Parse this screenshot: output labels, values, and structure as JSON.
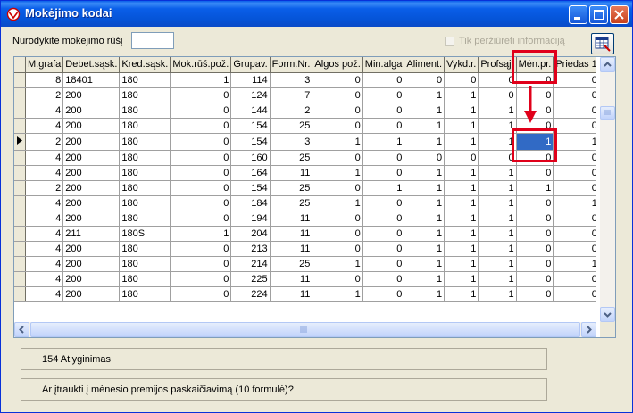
{
  "window": {
    "title": "Mokėjimo kodai"
  },
  "filter": {
    "code_label": "Nurodykite mokėjimo rūšį",
    "code_value": "",
    "view_only_label": "Tik peržiūrėti informaciją",
    "view_only_checked": false
  },
  "toolbar": {
    "tool_icon": "table-export-icon"
  },
  "grid": {
    "columns": [
      "M.grafa",
      "Debet.sąsk.",
      "Kred.sąsk.",
      "Mok.rūš.pož.",
      "Grupav.",
      "Form.Nr.",
      "Algos pož.",
      "Min.alga",
      "Aliment.",
      "Vykd.r.",
      "Profsąj.",
      "Mėn.pr.",
      "Priedas 1",
      "P"
    ],
    "rows": [
      [
        "8",
        "18401",
        "180",
        "1",
        "114",
        "3",
        "0",
        "0",
        "0",
        "0",
        "0",
        "0",
        "0",
        ""
      ],
      [
        "2",
        "200",
        "180",
        "0",
        "124",
        "7",
        "0",
        "0",
        "1",
        "1",
        "0",
        "0",
        "0",
        ""
      ],
      [
        "4",
        "200",
        "180",
        "0",
        "144",
        "2",
        "0",
        "0",
        "1",
        "1",
        "1",
        "0",
        "0",
        ""
      ],
      [
        "4",
        "200",
        "180",
        "0",
        "154",
        "25",
        "0",
        "0",
        "1",
        "1",
        "1",
        "0",
        "0",
        ""
      ],
      [
        "2",
        "200",
        "180",
        "0",
        "154",
        "3",
        "1",
        "1",
        "1",
        "1",
        "1",
        "1",
        "1",
        ""
      ],
      [
        "4",
        "200",
        "180",
        "0",
        "160",
        "25",
        "0",
        "0",
        "0",
        "0",
        "0",
        "0",
        "0",
        ""
      ],
      [
        "4",
        "200",
        "180",
        "0",
        "164",
        "11",
        "1",
        "0",
        "1",
        "1",
        "1",
        "0",
        "0",
        ""
      ],
      [
        "2",
        "200",
        "180",
        "0",
        "154",
        "25",
        "0",
        "1",
        "1",
        "1",
        "1",
        "1",
        "0",
        ""
      ],
      [
        "4",
        "200",
        "180",
        "0",
        "184",
        "25",
        "1",
        "0",
        "1",
        "1",
        "1",
        "0",
        "1",
        ""
      ],
      [
        "4",
        "200",
        "180",
        "0",
        "194",
        "11",
        "0",
        "0",
        "1",
        "1",
        "1",
        "0",
        "0",
        ""
      ],
      [
        "4",
        "211",
        "180S",
        "1",
        "204",
        "11",
        "0",
        "0",
        "1",
        "1",
        "1",
        "0",
        "0",
        ""
      ],
      [
        "4",
        "200",
        "180",
        "0",
        "213",
        "11",
        "0",
        "0",
        "1",
        "1",
        "1",
        "0",
        "0",
        ""
      ],
      [
        "4",
        "200",
        "180",
        "0",
        "214",
        "25",
        "1",
        "0",
        "1",
        "1",
        "1",
        "0",
        "1",
        ""
      ],
      [
        "4",
        "200",
        "180",
        "0",
        "225",
        "11",
        "0",
        "0",
        "1",
        "1",
        "1",
        "0",
        "0",
        ""
      ],
      [
        "4",
        "200",
        "180",
        "0",
        "224",
        "11",
        "1",
        "0",
        "1",
        "1",
        "1",
        "0",
        "0",
        ""
      ]
    ],
    "current_row": 4,
    "selected_col": 11
  },
  "status": {
    "info_text": "154 Atlyginimas",
    "question_text": "Ar įtraukti į mėnesio premijos paskaičiavimą (10 formulė)?"
  }
}
